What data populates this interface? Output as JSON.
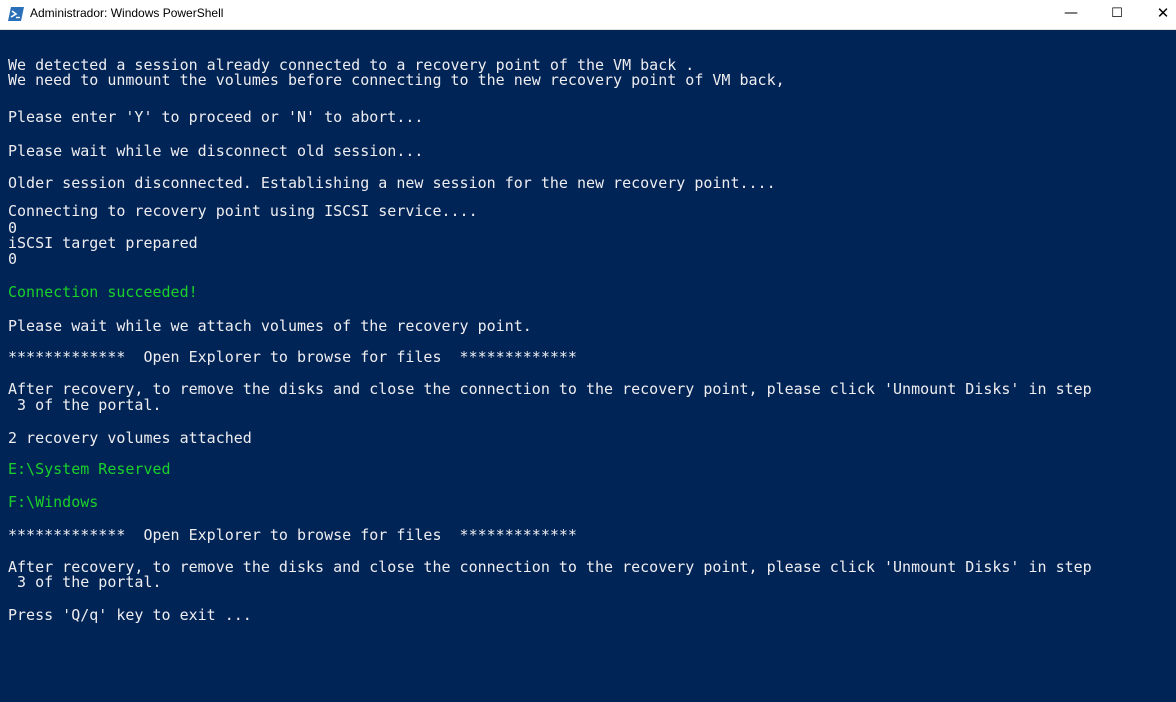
{
  "window": {
    "title": "Administrador: Windows PowerShell",
    "icon": "powershell-icon",
    "minimize_glyph": "—",
    "maximize_glyph": "☐",
    "close_glyph": "✕"
  },
  "colors": {
    "background": "#012456",
    "text": "#eeedf0",
    "success": "#19d12a"
  },
  "console": {
    "lines": [
      "We detected a session already connected to a recovery point of the VM back .",
      "We need to unmount the volumes before connecting to the new recovery point of VM back,",
      "Please enter 'Y' to proceed or 'N' to abort...",
      "Please wait while we disconnect old session...",
      "Older session disconnected. Establishing a new session for the new recovery point....",
      "Connecting to recovery point using ISCSI service....",
      "0",
      "iSCSI target prepared",
      "0",
      "Connection succeeded!",
      "Please wait while we attach volumes of the recovery point.",
      "*************  Open Explorer to browse for files  *************",
      "After recovery, to remove the disks and close the connection to the recovery point, please click 'Unmount Disks' in step",
      " 3 of the portal.",
      "2 recovery volumes attached",
      "E:\\System Reserved",
      "F:\\Windows",
      "*************  Open Explorer to browse for files  *************",
      "After recovery, to remove the disks and close the connection to the recovery point, please click 'Unmount Disks' in step",
      " 3 of the portal.",
      "Press 'Q/q' key to exit ..."
    ]
  }
}
